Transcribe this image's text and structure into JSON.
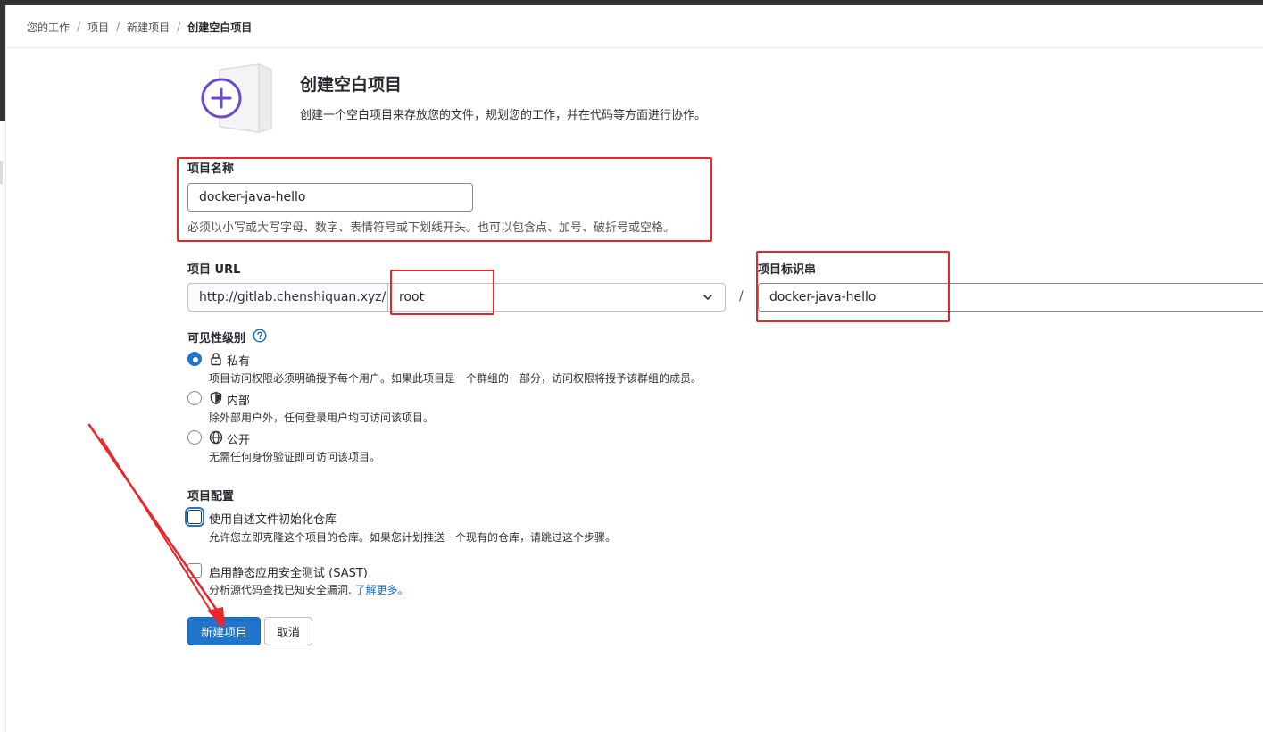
{
  "breadcrumb": {
    "items": [
      "您的工作",
      "项目",
      "新建项目"
    ],
    "current": "创建空白项目",
    "separator": "/"
  },
  "header": {
    "title": "创建空白项目",
    "description": "创建一个空白项目来存放您的文件，规划您的工作，并在代码等方面进行协作。"
  },
  "project_name": {
    "label": "项目名称",
    "value": "docker-java-hello",
    "help": "必须以小写或大写字母、数字、表情符号或下划线开头。也可以包含点、加号、破折号或空格。"
  },
  "project_url": {
    "label": "项目 URL",
    "prefix": "http://gitlab.chenshiquan.xyz/",
    "namespace": "root",
    "separator": "/"
  },
  "project_slug": {
    "label": "项目标识串",
    "value": "docker-java-hello"
  },
  "visibility": {
    "label": "可见性级别",
    "options": [
      {
        "label": "私有",
        "desc": "项目访问权限必须明确授予每个用户。如果此项目是一个群组的一部分，访问权限将授予该群组的成员。",
        "icon": "lock-icon",
        "selected": true
      },
      {
        "label": "内部",
        "desc": "除外部用户外，任何登录用户均可访问该项目。",
        "icon": "shield-icon",
        "selected": false
      },
      {
        "label": "公开",
        "desc": "无需任何身份验证即可访问该项目。",
        "icon": "globe-icon",
        "selected": false
      }
    ]
  },
  "config": {
    "label": "项目配置",
    "readme": {
      "label": "使用自述文件初始化仓库",
      "desc": "允许您立即克隆这个项目的仓库。如果您计划推送一个现有的仓库，请跳过这个步骤。",
      "checked": false
    },
    "sast": {
      "label": "启用静态应用安全测试 (SAST)",
      "desc": "分析源代码查找已知安全漏洞.",
      "link": "了解更多。",
      "checked": false
    }
  },
  "actions": {
    "create": "新建项目",
    "cancel": "取消"
  },
  "colors": {
    "primary": "#1f75cb",
    "annotation": "#e8262b",
    "illustration_purple": "#6e49cb"
  }
}
